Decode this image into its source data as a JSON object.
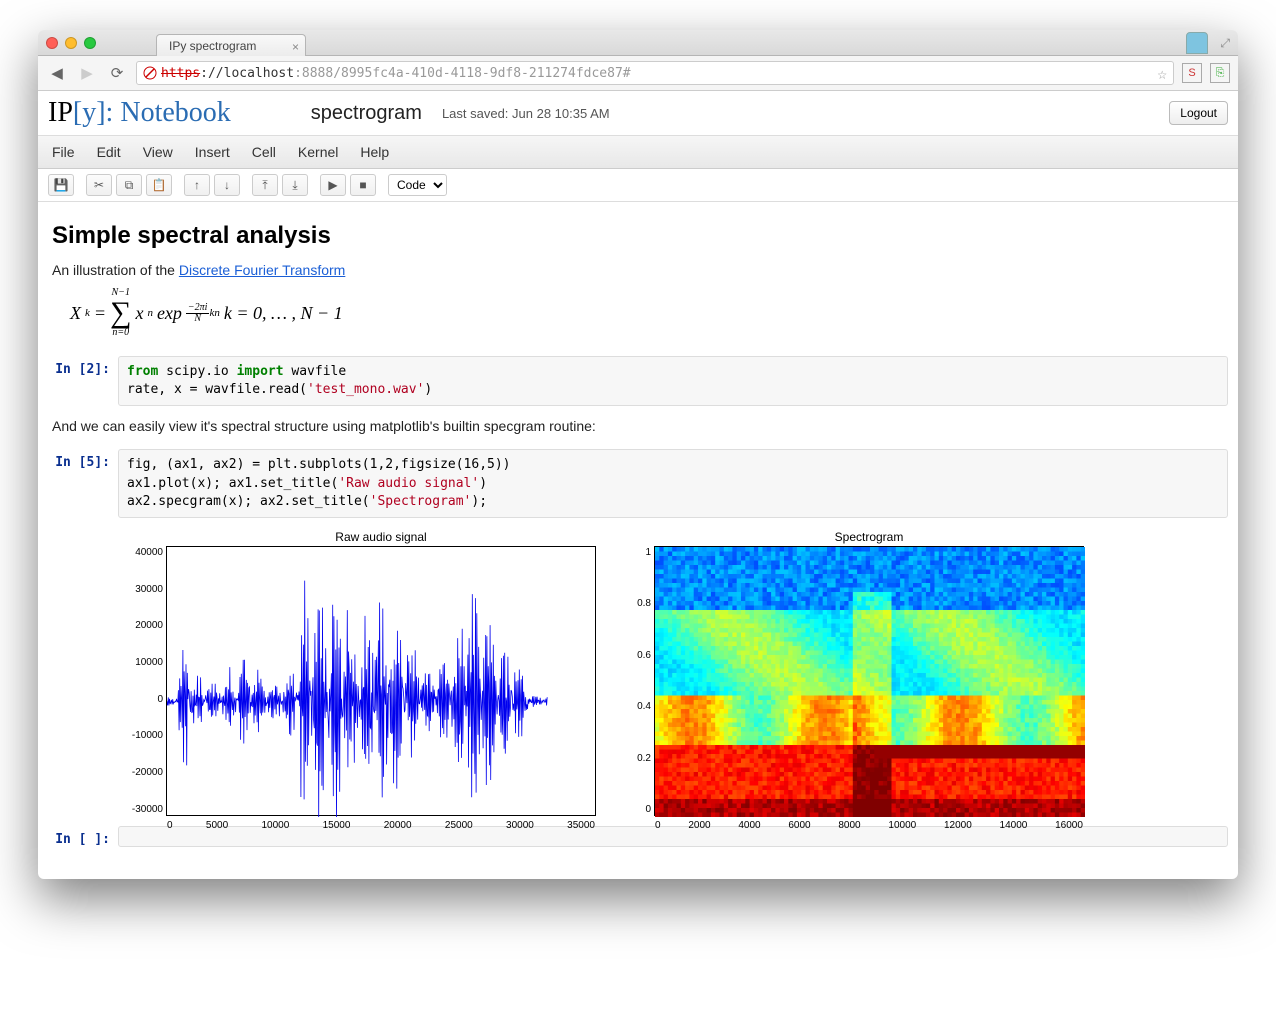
{
  "browser": {
    "tab_title": "IPy spectrogram",
    "url_scheme": "https",
    "url_host": "://localhost",
    "url_port": ":8888",
    "url_path": "/8995fc4a-410d-4118-9df8-211274fdce87#"
  },
  "header": {
    "logo_ip": "IP",
    "logo_y": "[y]:",
    "logo_nb": "Notebook",
    "notebook_name": "spectrogram",
    "last_saved": "Last saved: Jun 28 10:35 AM",
    "logout": "Logout"
  },
  "menus": [
    "File",
    "Edit",
    "View",
    "Insert",
    "Cell",
    "Kernel",
    "Help"
  ],
  "toolbar": {
    "cell_type": "Code",
    "icons": {
      "save": "💾",
      "cut": "✂",
      "copy": "⧉",
      "paste": "📋",
      "up": "↑",
      "down": "↓",
      "run_above": "⤒",
      "run_below": "⤓",
      "run": "▶",
      "stop": "■"
    }
  },
  "md1": {
    "h1": "Simple spectral analysis",
    "intro_pre": "An illustration of the ",
    "intro_link": "Discrete Fourier Transform",
    "formula_lhs": "X",
    "formula_k": "k",
    "formula_eq": " = ",
    "formula_Nm1": "N−1",
    "formula_n0": "n=0",
    "formula_xn": "x",
    "formula_n": "n",
    "formula_exp": "exp",
    "formula_frac_num": "−2πi",
    "formula_frac_den": "N",
    "formula_kn": "kn",
    "formula_range": "   k = 0, … , N − 1"
  },
  "cell2": {
    "prompt": "In [2]:",
    "line1_a": "from",
    "line1_b": " scipy.io ",
    "line1_c": "import",
    "line1_d": " wavfile",
    "line2_a": "rate, x = wavfile.read(",
    "line2_b": "'test_mono.wav'",
    "line2_c": ")"
  },
  "md2": {
    "text": "And we can easily view it's spectral structure using matplotlib's builtin specgram routine:"
  },
  "cell5": {
    "prompt": "In [5]:",
    "line1": "fig, (ax1, ax2) = plt.subplots(1,2,figsize(16,5))",
    "line2_a": "ax1.plot(x); ax1.set_title(",
    "line2_b": "'Raw audio signal'",
    "line2_c": ")",
    "line3_a": "ax2.specgram(x); ax2.set_title(",
    "line3_b": "'Spectrogram'",
    "line3_c": ");"
  },
  "empty_cell": {
    "prompt": "In [ ]:"
  },
  "chart_data": [
    {
      "type": "line",
      "title": "Raw audio signal",
      "xlim": [
        0,
        35000
      ],
      "ylim": [
        -30000,
        40000
      ],
      "xticks": [
        0,
        5000,
        10000,
        15000,
        20000,
        25000,
        30000,
        35000
      ],
      "yticks": [
        -30000,
        -20000,
        -10000,
        0,
        10000,
        20000,
        30000,
        40000
      ],
      "description": "Dense blue audio waveform ~31000 samples, amplitude roughly ±30000, burst around 12000-14000"
    },
    {
      "type": "heatmap",
      "title": "Spectrogram",
      "xlim": [
        0,
        16000
      ],
      "ylim": [
        0.0,
        1.0
      ],
      "xticks": [
        0,
        2000,
        4000,
        6000,
        8000,
        10000,
        12000,
        14000,
        16000
      ],
      "yticks": [
        0.0,
        0.2,
        0.4,
        0.6,
        0.8,
        1.0
      ],
      "colormap": "jet",
      "description": "Spectrogram: high energy (red/orange) at low freq <0.3, cyan/blue at high freq"
    }
  ]
}
